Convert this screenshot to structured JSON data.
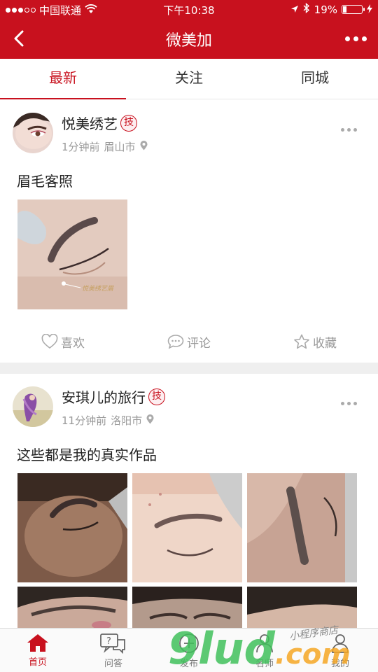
{
  "status_bar": {
    "carrier": "中国联通",
    "time": "下午10:38",
    "battery": "19%",
    "battery_level": 0.19
  },
  "nav": {
    "title": "微美加"
  },
  "tabs": [
    {
      "label": "最新",
      "active": true
    },
    {
      "label": "关注",
      "active": false
    },
    {
      "label": "同城",
      "active": false
    }
  ],
  "posts": [
    {
      "author": "悦美绣艺",
      "badge": "技",
      "time_ago": "1分钟前",
      "city": "眉山市",
      "title": "眉毛客照",
      "photo_caption": "悦美绣艺眉"
    },
    {
      "author": "安琪儿的旅行",
      "badge": "技",
      "time_ago": "11分钟前",
      "city": "洛阳市",
      "title": "这些都是我的真实作品"
    }
  ],
  "post_actions": {
    "like": "喜欢",
    "comment": "评论",
    "favorite": "收藏"
  },
  "tabbar": [
    {
      "label": "首页",
      "icon": "home-icon",
      "active": true
    },
    {
      "label": "问答",
      "icon": "question-chat-icon",
      "active": false
    },
    {
      "label": "发布",
      "icon": "add-circle-icon",
      "active": false
    },
    {
      "label": "名师",
      "icon": "teacher-icon",
      "active": false
    },
    {
      "label": "我的",
      "icon": "profile-icon",
      "active": false
    }
  ],
  "watermark": {
    "logo": "9lud.com",
    "tagline": "小程序商店"
  },
  "colors": {
    "brand_red": "#c8111e",
    "watermark_green": "#3fc05a",
    "watermark_orange": "#f5a623"
  }
}
